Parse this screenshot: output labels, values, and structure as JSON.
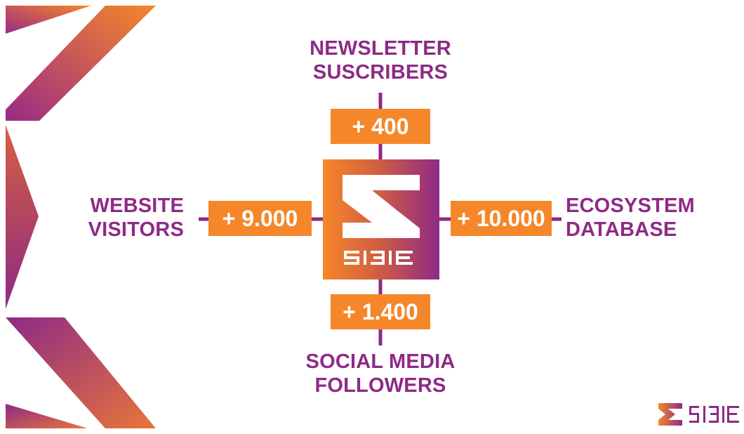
{
  "diagram": {
    "top": {
      "label_line1": "NEWSLETTER",
      "label_line2": "SUSCRIBERS",
      "value": "+ 400"
    },
    "left": {
      "label_line1": "WEBSITE",
      "label_line2": "VISITORS",
      "value": "+ 9.000"
    },
    "right": {
      "label_line1": "ECOSYSTEM",
      "label_line2": "DATABASE",
      "value": "+ 10.000"
    },
    "bottom": {
      "label_line1": "SOCIAL MEDIA",
      "label_line2": "FOLLOWERS",
      "value": "+ 1.400"
    }
  },
  "colors": {
    "purple": "#8e2a86",
    "orange": "#f5872a",
    "white": "#ffffff"
  },
  "icons": {
    "hub_logo": "sibe-logo",
    "corner_logo": "sibe-logo"
  }
}
